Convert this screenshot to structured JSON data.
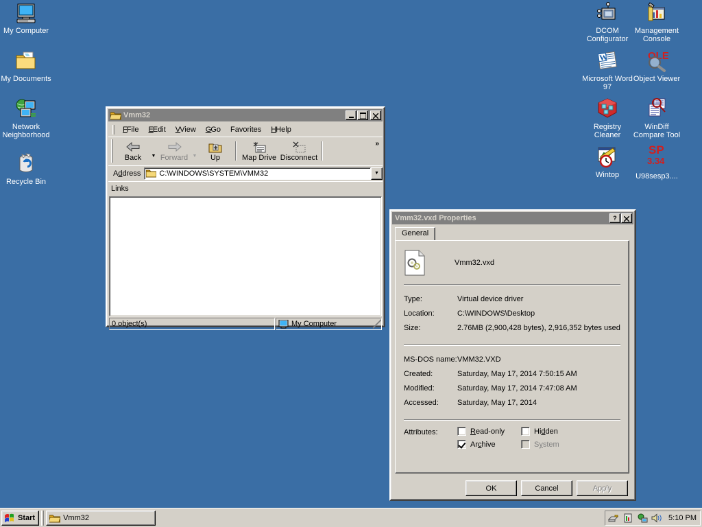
{
  "desktop": {
    "background_color": "#3a6ea5",
    "icons_left": [
      {
        "name": "my-computer",
        "label": "My Computer",
        "icon": "computer-icon"
      },
      {
        "name": "my-documents",
        "label": "My Documents",
        "icon": "folder-documents-icon"
      },
      {
        "name": "network-neighborhood",
        "label": "Network Neighborhood",
        "icon": "network-icon"
      },
      {
        "name": "recycle-bin",
        "label": "Recycle Bin",
        "icon": "recycle-bin-icon"
      }
    ],
    "icons_right": [
      {
        "name": "dcom-configurator",
        "label": "DCOM Configurator",
        "icon": "dcom-icon"
      },
      {
        "name": "management-console",
        "label": "Management Console",
        "icon": "mmc-icon"
      },
      {
        "name": "microsoft-word-97",
        "label": "Microsoft Word 97",
        "icon": "word-icon"
      },
      {
        "name": "object-viewer",
        "label": "Object Viewer",
        "icon": "ole-viewer-icon"
      },
      {
        "name": "registry-cleaner",
        "label": "Registry Cleaner",
        "icon": "registry-cleaner-icon"
      },
      {
        "name": "windiff-compare-tool",
        "label": "WinDiff Compare Tool",
        "icon": "windiff-icon"
      },
      {
        "name": "wintop",
        "label": "Wintop",
        "icon": "wintop-icon"
      },
      {
        "name": "u98sesp3",
        "label": "U98sesp3....",
        "icon": "sp-icon",
        "icon_text_top": "SP",
        "icon_text_bottom": "3.34"
      }
    ]
  },
  "explorer": {
    "title": "Vmm32",
    "title_icon": "folder-open-icon",
    "window_buttons": {
      "minimize": "_",
      "maximize": "□",
      "close": "✕"
    },
    "menu": [
      {
        "label": "File",
        "accel": "F"
      },
      {
        "label": "Edit",
        "accel": "E"
      },
      {
        "label": "View",
        "accel": "V"
      },
      {
        "label": "Go",
        "accel": "G"
      },
      {
        "label": "Favorites",
        "accel": "a"
      },
      {
        "label": "Help",
        "accel": "H"
      }
    ],
    "toolbar": [
      {
        "name": "back",
        "label": "Back",
        "icon": "arrow-left-icon",
        "enabled": true,
        "has_dropdown": true
      },
      {
        "name": "forward",
        "label": "Forward",
        "icon": "arrow-right-icon",
        "enabled": false,
        "has_dropdown": true
      },
      {
        "name": "up",
        "label": "Up",
        "icon": "folder-up-icon",
        "enabled": true,
        "has_dropdown": false
      },
      {
        "name": "map-drive",
        "label": "Map Drive",
        "icon": "map-drive-icon",
        "enabled": true,
        "has_dropdown": false
      },
      {
        "name": "disconnect",
        "label": "Disconnect",
        "icon": "disconnect-icon",
        "enabled": true,
        "has_dropdown": false
      }
    ],
    "toolbar_overflow": "»",
    "address": {
      "label": "Address",
      "label_accel": "d",
      "value": "C:\\WINDOWS\\SYSTEM\\VMM32",
      "icon": "folder-icon"
    },
    "links_label": "Links",
    "status": {
      "objects": "0 object(s)",
      "zone": "My Computer",
      "zone_icon": "computer-small-icon"
    }
  },
  "properties": {
    "title": "Vmm32.vxd Properties",
    "help_button": "?",
    "close_button": "✕",
    "tabs": [
      {
        "label": "General",
        "active": true
      }
    ],
    "file_icon": "vxd-file-icon",
    "file_name": "Vmm32.vxd",
    "info": [
      {
        "key": "Type:",
        "value": "Virtual device driver"
      },
      {
        "key": "Location:",
        "value": "C:\\WINDOWS\\Desktop"
      },
      {
        "key": "Size:",
        "value": "2.76MB (2,900,428 bytes), 2,916,352 bytes used"
      }
    ],
    "dates": [
      {
        "key": "MS-DOS name:",
        "value": "VMM32.VXD"
      },
      {
        "key": "Created:",
        "value": "Saturday, May 17, 2014 7:50:15 AM"
      },
      {
        "key": "Modified:",
        "value": "Saturday, May 17, 2014 7:47:08 AM"
      },
      {
        "key": "Accessed:",
        "value": "Saturday, May 17, 2014"
      }
    ],
    "attributes_label": "Attributes:",
    "attributes": [
      {
        "name": "read-only",
        "label": "Read-only",
        "accel": "R",
        "checked": false,
        "enabled": true
      },
      {
        "name": "hidden",
        "label": "Hidden",
        "accel": "d",
        "checked": false,
        "enabled": true
      },
      {
        "name": "archive",
        "label": "Archive",
        "accel": "c",
        "checked": true,
        "enabled": true
      },
      {
        "name": "system",
        "label": "System",
        "accel": "y",
        "checked": false,
        "enabled": false
      }
    ],
    "buttons": [
      {
        "name": "ok",
        "label": "OK",
        "enabled": true
      },
      {
        "name": "cancel",
        "label": "Cancel",
        "enabled": true
      },
      {
        "name": "apply",
        "label": "Apply",
        "enabled": false
      }
    ]
  },
  "taskbar": {
    "start_label": "Start",
    "start_icon": "windows-flag-icon",
    "tasks": [
      {
        "label": "Vmm32",
        "icon": "folder-open-icon"
      }
    ],
    "tray_icons": [
      "printer-icon",
      "task-monitor-icon",
      "network-activity-icon",
      "volume-icon"
    ],
    "clock": "5:10 PM"
  }
}
